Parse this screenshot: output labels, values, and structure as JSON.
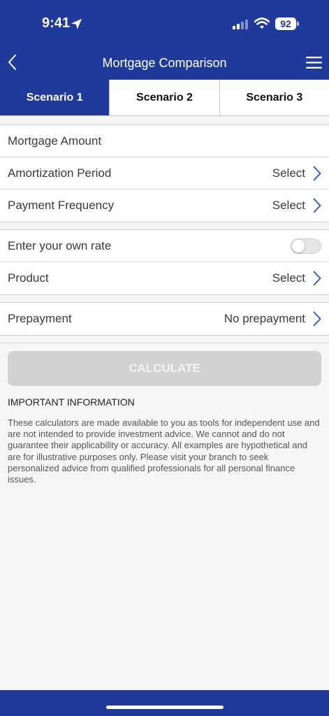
{
  "status_bar": {
    "time": "9:41",
    "battery": "92"
  },
  "nav": {
    "title": "Mortgage Comparison"
  },
  "tabs": [
    {
      "label": "Scenario 1",
      "active": true
    },
    {
      "label": "Scenario 2",
      "active": false
    },
    {
      "label": "Scenario 3",
      "active": false
    }
  ],
  "form": {
    "mortgage_amount": {
      "label": "Mortgage Amount"
    },
    "amortization_period": {
      "label": "Amortization Period",
      "value": "Select"
    },
    "payment_frequency": {
      "label": "Payment Frequency",
      "value": "Select"
    },
    "own_rate": {
      "label": "Enter your own rate",
      "enabled": false
    },
    "product": {
      "label": "Product",
      "value": "Select"
    },
    "prepayment": {
      "label": "Prepayment",
      "value": "No prepayment"
    }
  },
  "calculate_label": "CALCULATE",
  "info": {
    "heading": "IMPORTANT INFORMATION",
    "text": "These calculators are made available to you as tools for independent use and are not intended to provide investment advice. We cannot and do not guarantee their applicability or accuracy. All examples are hypothetical and are for illustrative purposes only. Please visit your branch to seek personalized advice from qualified professionals for all personal finance issues."
  },
  "colors": {
    "brand_blue": "#1f3a9a",
    "chevron_blue": "#2a56c6",
    "button_disabled": "#d2d2d2",
    "background": "#f6f6f6"
  },
  "icons": [
    "location-arrow-icon",
    "signal-icon",
    "wifi-icon",
    "battery-icon",
    "back-chevron-icon",
    "hamburger-menu-icon",
    "chevron-right-icon"
  ]
}
